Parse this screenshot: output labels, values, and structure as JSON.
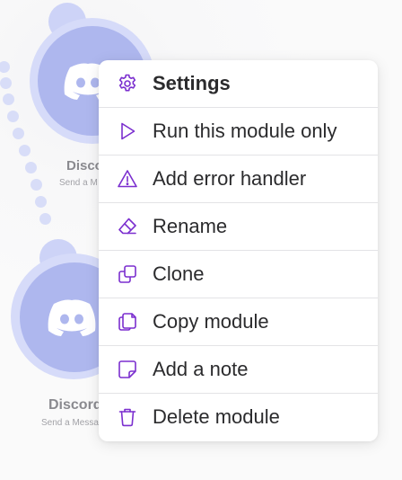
{
  "colors": {
    "accent": "#7b2fcf",
    "node_fill": "#aeb7ee",
    "node_halo": "#d6dbf9",
    "text": "#2b2b2d"
  },
  "nodes": [
    {
      "title": "Disco",
      "subtitle": "Send a M",
      "icon": "discord-logo-icon"
    },
    {
      "title": "Discord",
      "subtitle": "Send a Messa",
      "icon": "discord-logo-icon"
    }
  ],
  "menu": {
    "items": [
      {
        "label": "Settings",
        "icon": "gear-icon"
      },
      {
        "label": "Run this module only",
        "icon": "play-icon"
      },
      {
        "label": "Add error handler",
        "icon": "warning-icon"
      },
      {
        "label": "Rename",
        "icon": "eraser-icon"
      },
      {
        "label": "Clone",
        "icon": "clone-icon"
      },
      {
        "label": "Copy module",
        "icon": "copy-icon"
      },
      {
        "label": "Add a note",
        "icon": "note-icon"
      },
      {
        "label": "Delete module",
        "icon": "trash-icon"
      }
    ]
  }
}
